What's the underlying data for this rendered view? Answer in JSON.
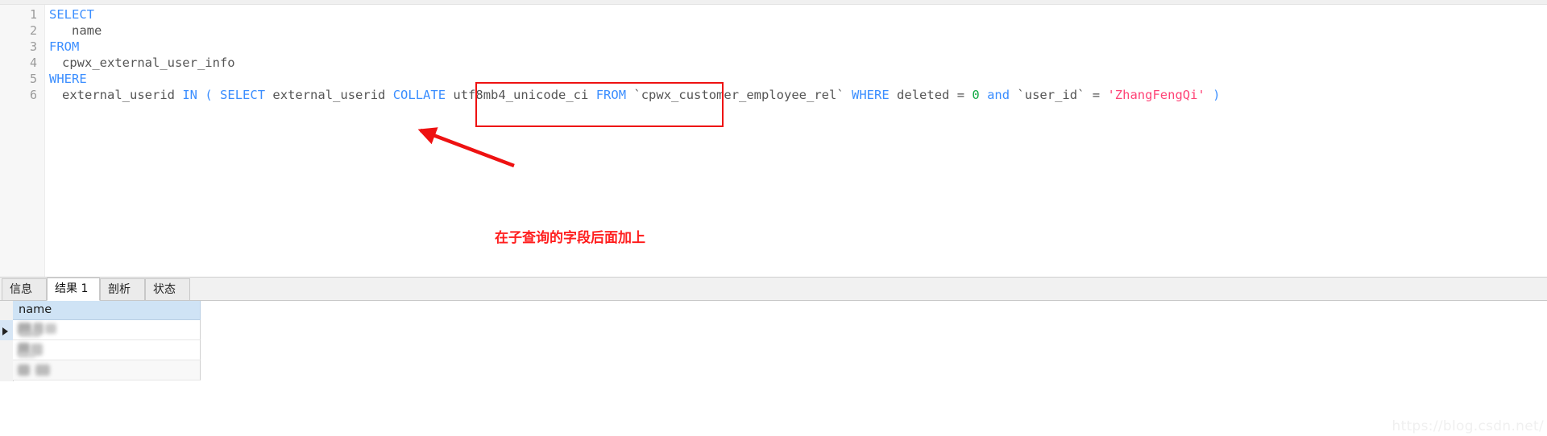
{
  "editor": {
    "line_numbers": [
      "1",
      "2",
      "3",
      "4",
      "5",
      "6"
    ],
    "lines": [
      {
        "n": "1",
        "text": "SELECT"
      },
      {
        "n": "2",
        "text": "name"
      },
      {
        "n": "3",
        "text": "FROM"
      },
      {
        "n": "4",
        "text": "cpwx_external_user_info"
      },
      {
        "n": "5",
        "text": "WHERE"
      },
      {
        "n": "6",
        "text": "external_userid IN ( SELECT external_userid COLLATE utf8mb4_unicode_ci FROM `cpwx_customer_employee_rel` WHERE deleted = 0 and `user_id` = 'ZhangFengQi' )"
      }
    ],
    "line1": {
      "kw_select": "SELECT"
    },
    "line2": {
      "ident_name": "name"
    },
    "line3": {
      "kw_from": "FROM"
    },
    "line4": {
      "ident_table": "cpwx_external_user_info"
    },
    "line5": {
      "kw_where": "WHERE"
    },
    "line6": {
      "ident_col": "external_userid",
      "kw_in": "IN",
      "paren_open": "(",
      "kw_select": "SELECT",
      "ident_subcol": "external_userid",
      "kw_collate": "COLLATE",
      "ident_collation": "utf8mb4_unicode_ci",
      "kw_from": "FROM",
      "ident_subtable": "`cpwx_customer_employee_rel`",
      "kw_where": "WHERE",
      "ident_deleted": "deleted",
      "op_eq1": "=",
      "num_zero": "0",
      "kw_and": "and",
      "ident_userid": "`user_id`",
      "op_eq2": "=",
      "str_value": "'ZhangFengQi'",
      "paren_close": ")"
    },
    "colors": {
      "keyword": "#3b8eff",
      "identifier": "#555555",
      "number": "#11aa44",
      "string": "#ff4477",
      "gutter_text": "#9a9a9a"
    }
  },
  "annotation": {
    "box_label": "COLLATE utf8mb4_unicode_ci",
    "text": "在子查询的字段后面加上",
    "color": "#ff1e1e",
    "arrow_from": "annotation-text",
    "arrow_to": "external_userid"
  },
  "bottom_panel": {
    "tabs": [
      {
        "label": "信息",
        "active": false
      },
      {
        "label": "结果 1",
        "active": true
      },
      {
        "label": "剖析",
        "active": false
      },
      {
        "label": "状态",
        "active": false
      }
    ],
    "result_grid": {
      "columns": [
        "name"
      ],
      "rows": [
        {
          "name": "",
          "selected": true
        },
        {
          "name": "",
          "selected": false
        },
        {
          "name": "",
          "selected": false
        }
      ]
    }
  },
  "watermark": {
    "text": "https://blog.csdn.net/"
  }
}
